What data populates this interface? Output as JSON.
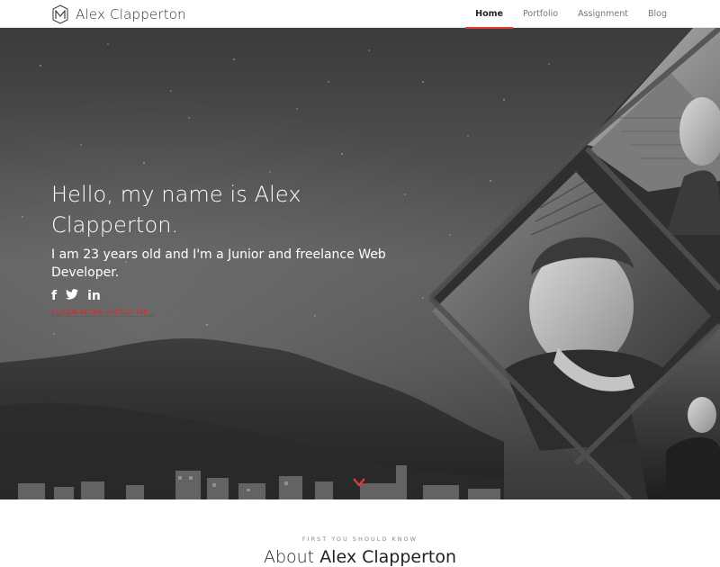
{
  "navbar": {
    "brand_name": "Alex Clapperton",
    "logo_icon": "monogram-logo-icon",
    "links": [
      {
        "label": "Home",
        "active": true
      },
      {
        "label": "Portfolio",
        "active": false
      },
      {
        "label": "Assignment",
        "active": false
      },
      {
        "label": "Blog",
        "active": false
      }
    ]
  },
  "hero": {
    "title": "Hello, my name is Alex Clapperton.",
    "subtitle": "I am 23 years old and I'm a Junior and freelance Web Developer.",
    "social": [
      {
        "icon": "facebook-icon",
        "glyph": "f"
      },
      {
        "icon": "twitter-icon",
        "glyph": "t"
      },
      {
        "icon": "linkedin-icon",
        "glyph": "in"
      }
    ],
    "learn_more": "LEARN MORE ABOUT ME...",
    "scroll_icon": "chevron-down-icon"
  },
  "about": {
    "eyebrow": "FIRST YOU SHOULD KNOW",
    "heading_light": "About",
    "heading_strong": "Alex Clapperton"
  },
  "colors": {
    "accent": "#e53935",
    "link_red": "#d32f2f",
    "hero_gray": "#4c4c4c"
  }
}
